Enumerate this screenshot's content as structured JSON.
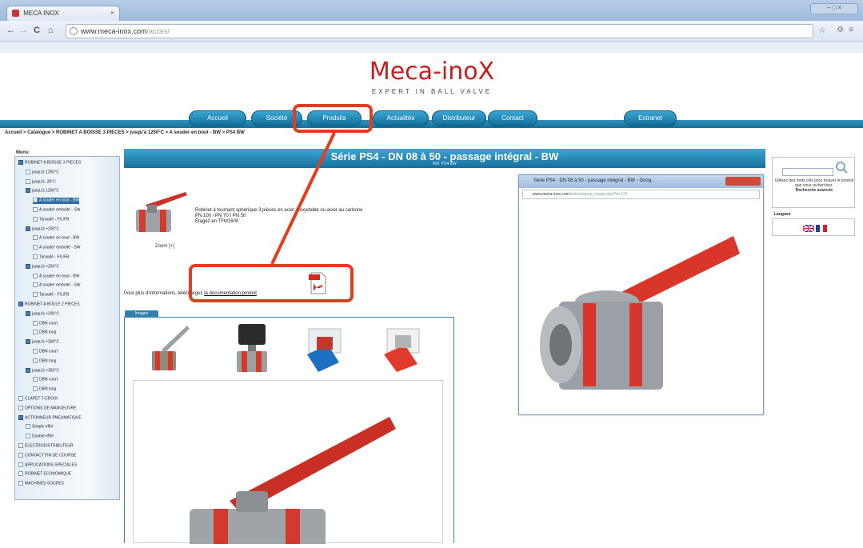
{
  "browser": {
    "tab_title": "MECA INOX",
    "tab_close": "×",
    "window_controls": "– □ ×",
    "nav": {
      "back": "←",
      "forward": "→",
      "reload": "C",
      "home": "⌂"
    },
    "url_host": "www.meca-inox.com",
    "url_path": "/acces/",
    "star": "☆",
    "extensions": "⚙≡"
  },
  "site": {
    "logo_name": "Meca-inoX",
    "logo_tagline": "EXPERT IN BALL VALVE",
    "nav": [
      "Accueil",
      "Société",
      "Produits",
      "Actualités",
      "Distributeur",
      "Contact"
    ],
    "extranet": "Extranet",
    "breadcrumb": "Accueil > Catalogue > ROBINET A BOISSE 3 PIECES > jusqu'à 1250°C > A souder en bout - BW > PS4 BW"
  },
  "menu": {
    "label": "Menu",
    "items": [
      {
        "label": "ROBINET A BOISSE 3 PIECES",
        "indent": 0,
        "folder": true
      },
      {
        "label": "jusqu'à 1250°C",
        "indent": 1
      },
      {
        "label": "jusqu'à -30°C",
        "indent": 1
      },
      {
        "label": "jusqu'à 1200°C",
        "indent": 1,
        "folder": true
      },
      {
        "label": "A souder en bout - BW",
        "indent": 2,
        "selected": true
      },
      {
        "label": "A souder emboité - SW",
        "indent": 2
      },
      {
        "label": "Taraudé - F/L/FB",
        "indent": 2
      },
      {
        "label": "jusqu'à +200°C",
        "indent": 1,
        "folder": true
      },
      {
        "label": "A souder en bout - BW",
        "indent": 2
      },
      {
        "label": "A souder emboité - SW",
        "indent": 2
      },
      {
        "label": "Taraudé - F/L/FB",
        "indent": 2
      },
      {
        "label": "jusqu'à +250°C",
        "indent": 1,
        "folder": true
      },
      {
        "label": "A souder en bout - BW",
        "indent": 2
      },
      {
        "label": "A souder emboité - SW",
        "indent": 2
      },
      {
        "label": "Taraudé - F/L/FB",
        "indent": 2
      },
      {
        "label": "ROBINET A BOULE 2 PIECES",
        "indent": 0,
        "folder": true
      },
      {
        "label": "jusqu'à +200°C",
        "indent": 1,
        "folder": true
      },
      {
        "label": "DBN court",
        "indent": 2
      },
      {
        "label": "DBN long",
        "indent": 2
      },
      {
        "label": "jusqu'à +300°C",
        "indent": 1,
        "folder": true
      },
      {
        "label": "DBN court",
        "indent": 2
      },
      {
        "label": "DBN long",
        "indent": 2
      },
      {
        "label": "jusqu'à +350°C",
        "indent": 1,
        "folder": true
      },
      {
        "label": "DBN court",
        "indent": 2
      },
      {
        "label": "DBN long",
        "indent": 2
      },
      {
        "label": "CLAPET T-CROIX",
        "indent": 0
      },
      {
        "label": "OPTIONS DE MANOEUVRE",
        "indent": 0
      },
      {
        "label": "ACTIONNEUR PNEUMATIQUE",
        "indent": 0,
        "folder": true
      },
      {
        "label": "Simple effet",
        "indent": 1
      },
      {
        "label": "Double effet",
        "indent": 1
      },
      {
        "label": "ELECTRODISTRIBUTEUR",
        "indent": 0
      },
      {
        "label": "CONTACT FIN DE COURSE",
        "indent": 0
      },
      {
        "label": "APPLICATIONS SPECIALES",
        "indent": 0
      },
      {
        "label": "ROBINET ECONOMIQUE",
        "indent": 0
      },
      {
        "label": "MACHINES SOUDES",
        "indent": 0
      }
    ]
  },
  "product": {
    "title": "Série PS4 - DN 08 à 50 - passage intégral - BW",
    "subtitle": "Réf. PS4 BW",
    "zoom_label": "Zoom [+]",
    "description": [
      "Robinet à tournant sphérique 3 pièces en acier inoxydable ou acier au carbone",
      "PN 100 / PN 70 / PN 50",
      "Étagez en TFM1600"
    ],
    "info_prefix": "Pour plus d'informations, téléchargez",
    "info_link": "la documentation produit",
    "images_tab": "Images"
  },
  "popup": {
    "title": "Série PS4 - DN 08 à 50 - passage intégral - BW - Goog...",
    "url_host": "www.meca-inox.com",
    "url_path": "/index/popup_image.php?id=122"
  },
  "sidebar_right": {
    "search_help": "Utilisez des mots clés pour trouver le produit que vous recherchez.",
    "advanced_search": "Recherche avancée",
    "languages_label": "Langues"
  },
  "colors": {
    "brand_red": "#c81d1d",
    "nav_blue": "#1a6f96",
    "annotation_red": "#e23d1f"
  }
}
